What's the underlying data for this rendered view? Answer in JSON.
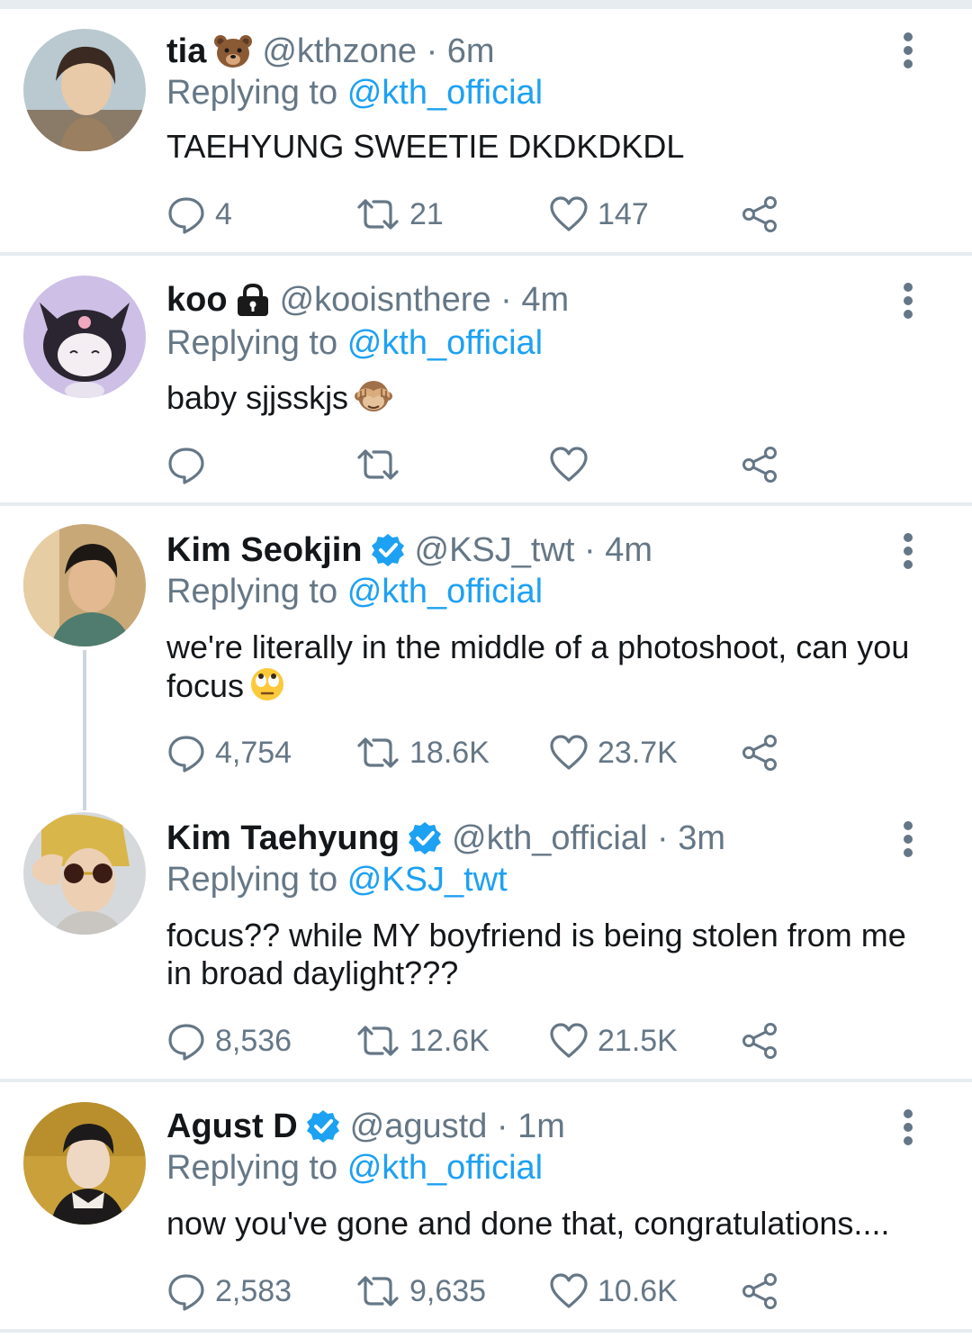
{
  "tweets": [
    {
      "name": "tia",
      "name_emoji": "bear-face-icon",
      "handle_time": "@kthzone · 6m",
      "replying_prefix": "Replying to",
      "replying_to": "@kth_official",
      "text": "TAEHYUNG SWEETIE DKDKDKDL",
      "replies": "4",
      "retweets": "21",
      "likes": "147"
    },
    {
      "name": "koo",
      "name_emoji": "lock-icon",
      "handle_time": "@kooisnthere · 4m",
      "replying_prefix": "Replying to",
      "replying_to": "@kth_official",
      "text": "baby sjjsskjs",
      "text_emoji": "see-no-evil-monkey-icon",
      "replies": "",
      "retweets": "",
      "likes": ""
    },
    {
      "name": "Kim Seokjin",
      "verified": true,
      "handle_time": "@KSJ_twt · 4m",
      "replying_prefix": "Replying to",
      "replying_to": "@kth_official",
      "text": "we're literally in the middle of a photoshoot, can you focus",
      "text_emoji": "face-with-rolling-eyes-icon",
      "replies": "4,754",
      "retweets": "18.6K",
      "likes": "23.7K"
    },
    {
      "name": "Kim Taehyung",
      "verified": true,
      "handle_time": "@kth_official · 3m",
      "replying_prefix": "Replying to",
      "replying_to": "@KSJ_twt",
      "text": "focus?? while MY boyfriend is being stolen from me in broad daylight???",
      "replies": "8,536",
      "retweets": "12.6K",
      "likes": "21.5K"
    },
    {
      "name": "Agust D",
      "verified": true,
      "handle_time": "@agustd · 1m",
      "replying_prefix": "Replying to",
      "replying_to": "@kth_official",
      "text": "now you've gone and done that, congratulations....",
      "replies": "2,583",
      "retweets": "9,635",
      "likes": "10.6K"
    }
  ],
  "colors": {
    "link": "#1da1f2",
    "muted": "#657786",
    "verified": "#1da1f2",
    "separator": "#e6ecf0"
  }
}
